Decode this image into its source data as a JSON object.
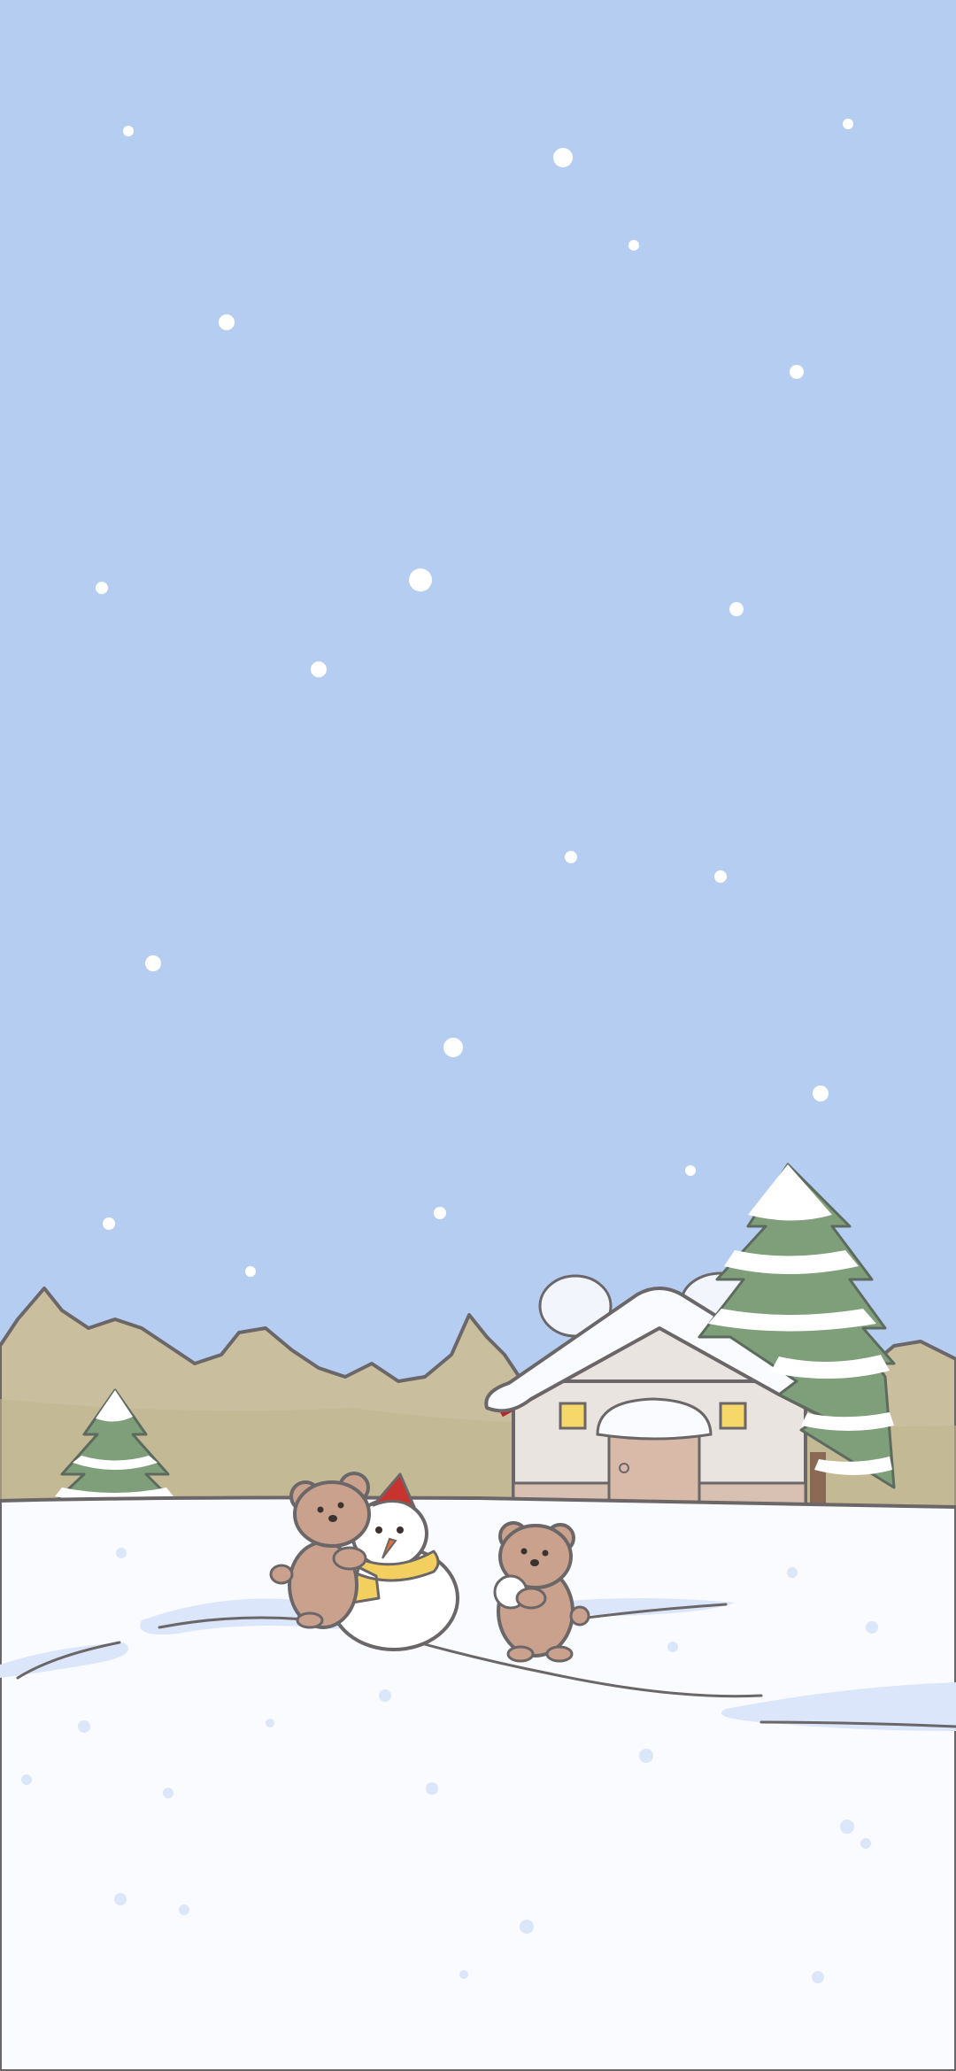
{
  "image": {
    "kind": "illustrated winter phone wallpaper",
    "palette": {
      "sky": "#b6cdf2",
      "snow": "#f9fbff",
      "snow_shadow": "#dbe6fb",
      "forest": "#c9bf9e",
      "tree_green": "#7f9e7a",
      "bear": "#caa18c",
      "bear_outline": "#6b5a55",
      "roof_red": "#b3262b",
      "house_wall": "#e9e4df",
      "door": "#d9b9a7",
      "window": "#f6d76a",
      "scarf": "#f3cf60",
      "hat": "#c73430",
      "carrot": "#e0713a"
    }
  }
}
